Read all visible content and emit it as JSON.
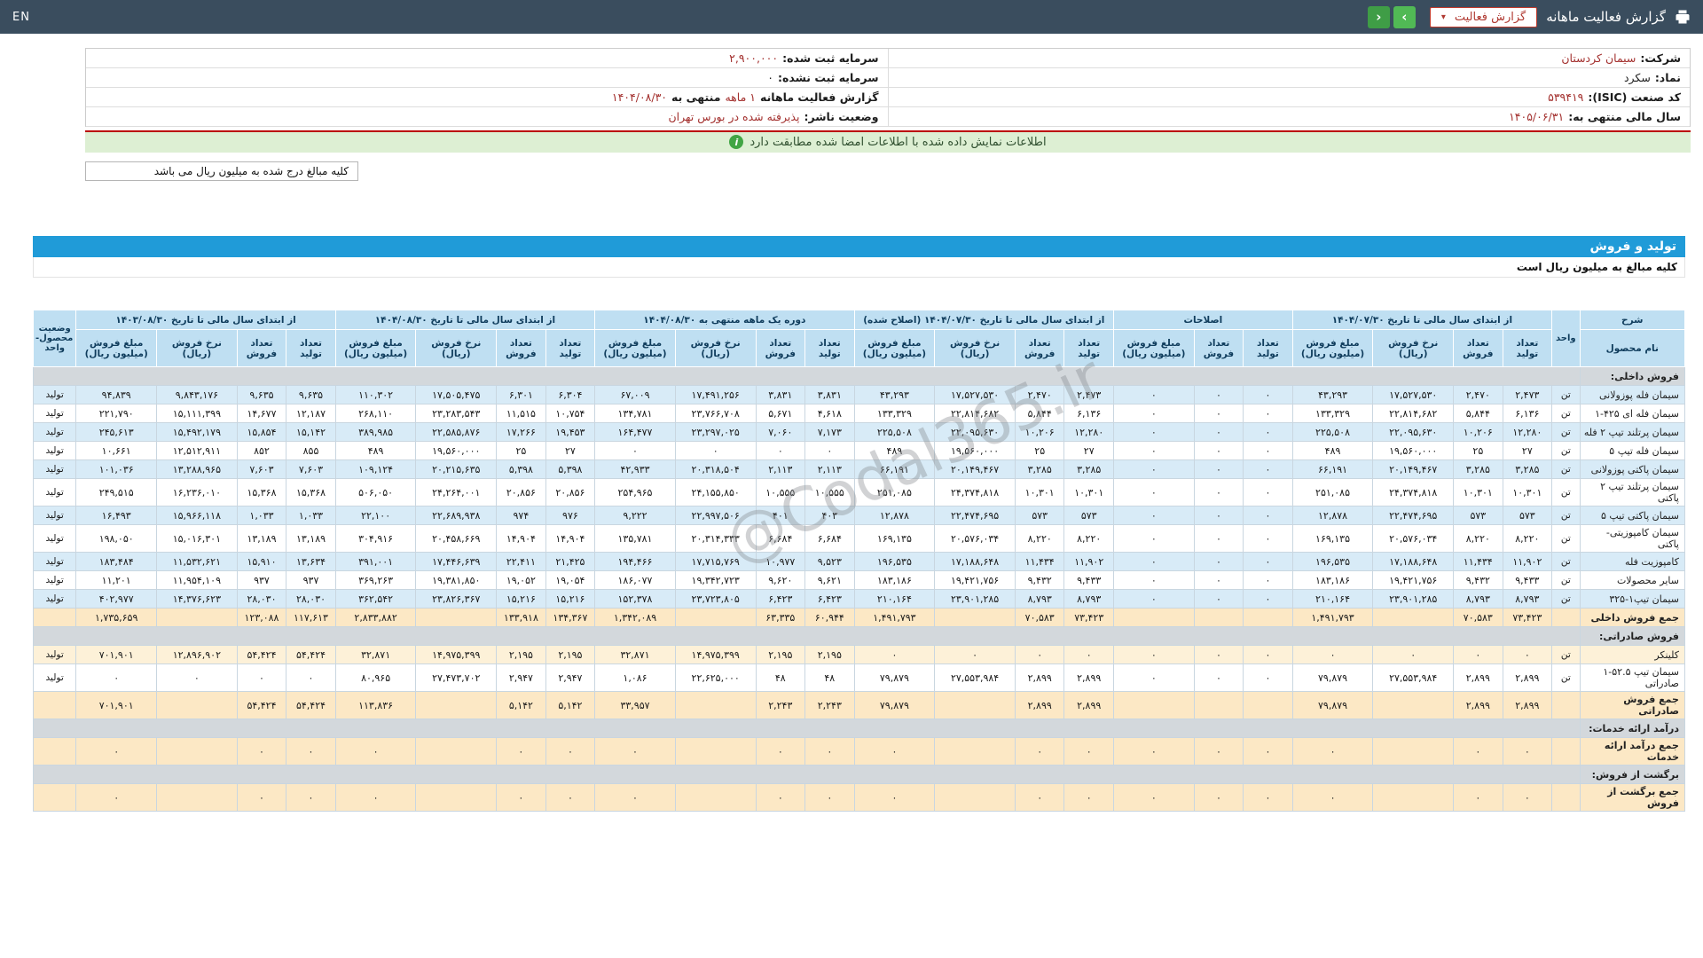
{
  "navbar": {
    "title": "گزارش فعالیت ماهانه",
    "report_select": "گزارش فعالیت",
    "prev": "‹",
    "next": "›",
    "lang": "EN"
  },
  "info": {
    "company_label": "شرکت:",
    "company": "سیمان کردستان",
    "symbol_label": "نماد:",
    "symbol": "سکرد",
    "isic_label": "کد صنعت (ISIC):",
    "isic": "۵۳۹۴۱۹",
    "fiscal_year_label": "سال مالی منتهی به:",
    "fiscal_year": "۱۴۰۵/۰۶/۳۱",
    "registered_capital_label": "سرمایه ثبت شده:",
    "registered_capital": "۲,۹۰۰,۰۰۰",
    "unregistered_capital_label": "سرمایه ثبت نشده:",
    "unregistered_capital": "۰",
    "report_period_label": "گزارش فعالیت ماهانه",
    "report_period": "۱ ماهه",
    "report_period_mid": "منتهی به",
    "report_period_date": "۱۴۰۴/۰۸/۳۰",
    "issuer_status_label": "وضعیت ناشر:",
    "issuer_status": "پذیرفته شده در بورس تهران"
  },
  "signature_notice": "اطلاعات نمایش داده شده با اطلاعات امضا شده مطابقت دارد",
  "info_icon": "i",
  "amounts_note": "کلیه مبالغ درج شده به میلیون ریال می باشد",
  "section_title": "تولید و فروش",
  "section_subtitle": "کلیه مبالغ به میلیون ریال است",
  "watermark": "@Codal365.ir",
  "table": {
    "desc_header": "شرح",
    "product_header": "نام محصول",
    "unit_header": "واحد",
    "status_header": "وضعیت محصول-واحد",
    "groups": [
      {
        "label": "از ابتدای سال مالی تا تاریخ ۱۴۰۴/۰۷/۳۰",
        "cols": [
          "تعداد تولید",
          "تعداد فروش",
          "نرخ فروش (ریال)",
          "مبلغ فروش (میلیون ریال)"
        ]
      },
      {
        "label": "اصلاحات",
        "cols": [
          "تعداد تولید",
          "تعداد فروش",
          "مبلغ فروش (میلیون ریال)"
        ]
      },
      {
        "label": "از ابتدای سال مالی تا تاریخ ۱۴۰۴/۰۷/۳۰ (اصلاح شده)",
        "cols": [
          "تعداد تولید",
          "تعداد فروش",
          "نرخ فروش (ریال)",
          "مبلغ فروش (میلیون ریال)"
        ]
      },
      {
        "label": "دوره یک ماهه منتهی به ۱۴۰۴/۰۸/۳۰",
        "cols": [
          "تعداد تولید",
          "تعداد فروش",
          "نرخ فروش (ریال)",
          "مبلغ فروش (میلیون ریال)"
        ]
      },
      {
        "label": "از ابتدای سال مالی تا تاریخ ۱۴۰۴/۰۸/۳۰",
        "cols": [
          "تعداد تولید",
          "تعداد فروش",
          "نرخ فروش (ریال)",
          "مبلغ فروش (میلیون ریال)"
        ]
      },
      {
        "label": "از ابتدای سال مالی تا تاریخ ۱۴۰۳/۰۸/۳۰",
        "cols": [
          "تعداد تولید",
          "تعداد فروش",
          "نرخ فروش (ریال)",
          "مبلغ فروش (میلیون ریال)"
        ]
      }
    ],
    "rows": [
      {
        "kind": "section",
        "name": "فروش داخلی:"
      },
      {
        "kind": "product",
        "shade": "blue",
        "name": "سیمان فله پوزولانی",
        "unit": "تن",
        "status": "تولید",
        "cells": [
          "۲,۴۷۳",
          "۲,۴۷۰",
          "۱۷,۵۲۷,۵۳۰",
          "۴۳,۲۹۳",
          "۰",
          "۰",
          "۰",
          "۲,۴۷۳",
          "۲,۴۷۰",
          "۱۷,۵۲۷,۵۳۰",
          "۴۳,۲۹۳",
          "۳,۸۳۱",
          "۳,۸۳۱",
          "۱۷,۴۹۱,۲۵۶",
          "۶۷,۰۰۹",
          "۶,۳۰۴",
          "۶,۳۰۱",
          "۱۷,۵۰۵,۴۷۵",
          "۱۱۰,۳۰۲",
          "۹,۶۳۵",
          "۹,۶۳۵",
          "۹,۸۴۳,۱۷۶",
          "۹۴,۸۳۹"
        ]
      },
      {
        "kind": "product",
        "shade": "white",
        "name": "سیمان فله ای ۴۲۵-۱",
        "unit": "تن",
        "status": "تولید",
        "cells": [
          "۶,۱۳۶",
          "۵,۸۴۴",
          "۲۲,۸۱۴,۶۸۲",
          "۱۳۳,۳۲۹",
          "۰",
          "۰",
          "۰",
          "۶,۱۳۶",
          "۵,۸۴۴",
          "۲۲,۸۱۴,۶۸۲",
          "۱۳۳,۳۲۹",
          "۴,۶۱۸",
          "۵,۶۷۱",
          "۲۳,۷۶۶,۷۰۸",
          "۱۳۴,۷۸۱",
          "۱۰,۷۵۴",
          "۱۱,۵۱۵",
          "۲۳,۲۸۳,۵۴۳",
          "۲۶۸,۱۱۰",
          "۱۲,۱۸۷",
          "۱۴,۶۷۷",
          "۱۵,۱۱۱,۳۹۹",
          "۲۲۱,۷۹۰"
        ]
      },
      {
        "kind": "product",
        "shade": "blue",
        "name": "سیمان پرتلند تیپ ۲ فله",
        "unit": "تن",
        "status": "تولید",
        "cells": [
          "۱۲,۲۸۰",
          "۱۰,۲۰۶",
          "۲۲,۰۹۵,۶۳۰",
          "۲۲۵,۵۰۸",
          "۰",
          "۰",
          "۰",
          "۱۲,۲۸۰",
          "۱۰,۲۰۶",
          "۲۲,۰۹۵,۶۳۰",
          "۲۲۵,۵۰۸",
          "۷,۱۷۳",
          "۷,۰۶۰",
          "۲۳,۲۹۷,۰۲۵",
          "۱۶۴,۴۷۷",
          "۱۹,۴۵۳",
          "۱۷,۲۶۶",
          "۲۲,۵۸۵,۸۷۶",
          "۳۸۹,۹۸۵",
          "۱۵,۱۴۲",
          "۱۵,۸۵۴",
          "۱۵,۴۹۲,۱۷۹",
          "۲۴۵,۶۱۳"
        ]
      },
      {
        "kind": "product",
        "shade": "white",
        "name": "سیمان فله تیپ ۵",
        "unit": "تن",
        "status": "تولید",
        "cells": [
          "۲۷",
          "۲۵",
          "۱۹,۵۶۰,۰۰۰",
          "۴۸۹",
          "۰",
          "۰",
          "۰",
          "۲۷",
          "۲۵",
          "۱۹,۵۶۰,۰۰۰",
          "۴۸۹",
          "۰",
          "۰",
          "۰",
          "۰",
          "۲۷",
          "۲۵",
          "۱۹,۵۶۰,۰۰۰",
          "۴۸۹",
          "۸۵۵",
          "۸۵۲",
          "۱۲,۵۱۲,۹۱۱",
          "۱۰,۶۶۱"
        ]
      },
      {
        "kind": "product",
        "shade": "blue",
        "name": "سیمان پاکتی پوزولانی",
        "unit": "تن",
        "status": "تولید",
        "cells": [
          "۳,۲۸۵",
          "۳,۲۸۵",
          "۲۰,۱۴۹,۴۶۷",
          "۶۶,۱۹۱",
          "۰",
          "۰",
          "۰",
          "۳,۲۸۵",
          "۳,۲۸۵",
          "۲۰,۱۴۹,۴۶۷",
          "۶۶,۱۹۱",
          "۲,۱۱۳",
          "۲,۱۱۳",
          "۲۰,۳۱۸,۵۰۴",
          "۴۲,۹۳۳",
          "۵,۳۹۸",
          "۵,۳۹۸",
          "۲۰,۲۱۵,۶۳۵",
          "۱۰۹,۱۲۴",
          "۷,۶۰۳",
          "۷,۶۰۳",
          "۱۳,۲۸۸,۹۶۵",
          "۱۰۱,۰۳۶"
        ]
      },
      {
        "kind": "product",
        "shade": "white",
        "name": "سیمان پرتلند تیپ ۲ پاکتی",
        "unit": "تن",
        "status": "تولید",
        "cells": [
          "۱۰,۳۰۱",
          "۱۰,۳۰۱",
          "۲۴,۳۷۴,۸۱۸",
          "۲۵۱,۰۸۵",
          "۰",
          "۰",
          "۰",
          "۱۰,۳۰۱",
          "۱۰,۳۰۱",
          "۲۴,۳۷۴,۸۱۸",
          "۲۵۱,۰۸۵",
          "۱۰,۵۵۵",
          "۱۰,۵۵۵",
          "۲۴,۱۵۵,۸۵۰",
          "۲۵۴,۹۶۵",
          "۲۰,۸۵۶",
          "۲۰,۸۵۶",
          "۲۴,۲۶۴,۰۰۱",
          "۵۰۶,۰۵۰",
          "۱۵,۳۶۸",
          "۱۵,۳۶۸",
          "۱۶,۲۳۶,۰۱۰",
          "۲۴۹,۵۱۵"
        ]
      },
      {
        "kind": "product",
        "shade": "blue",
        "name": "سیمان پاکتی تیپ ۵",
        "unit": "تن",
        "status": "تولید",
        "cells": [
          "۵۷۳",
          "۵۷۳",
          "۲۲,۴۷۴,۶۹۵",
          "۱۲,۸۷۸",
          "۰",
          "۰",
          "۰",
          "۵۷۳",
          "۵۷۳",
          "۲۲,۴۷۴,۶۹۵",
          "۱۲,۸۷۸",
          "۴۰۳",
          "۴۰۱",
          "۲۲,۹۹۷,۵۰۶",
          "۹,۲۲۲",
          "۹۷۶",
          "۹۷۴",
          "۲۲,۶۸۹,۹۳۸",
          "۲۲,۱۰۰",
          "۱,۰۳۳",
          "۱,۰۳۳",
          "۱۵,۹۶۶,۱۱۸",
          "۱۶,۴۹۳"
        ]
      },
      {
        "kind": "product",
        "shade": "white",
        "name": "سیمان کامپوزیتی- پاکتی",
        "unit": "تن",
        "status": "تولید",
        "cells": [
          "۸,۲۲۰",
          "۸,۲۲۰",
          "۲۰,۵۷۶,۰۳۴",
          "۱۶۹,۱۳۵",
          "۰",
          "۰",
          "۰",
          "۸,۲۲۰",
          "۸,۲۲۰",
          "۲۰,۵۷۶,۰۳۴",
          "۱۶۹,۱۳۵",
          "۶,۶۸۴",
          "۶,۶۸۴",
          "۲۰,۳۱۴,۳۳۳",
          "۱۳۵,۷۸۱",
          "۱۴,۹۰۴",
          "۱۴,۹۰۴",
          "۲۰,۴۵۸,۶۶۹",
          "۳۰۴,۹۱۶",
          "۱۳,۱۸۹",
          "۱۳,۱۸۹",
          "۱۵,۰۱۶,۳۰۱",
          "۱۹۸,۰۵۰"
        ]
      },
      {
        "kind": "product",
        "shade": "blue",
        "name": "کامپوزیت فله",
        "unit": "تن",
        "status": "تولید",
        "cells": [
          "۱۱,۹۰۲",
          "۱۱,۴۳۴",
          "۱۷,۱۸۸,۶۴۸",
          "۱۹۶,۵۳۵",
          "۰",
          "۰",
          "۰",
          "۱۱,۹۰۲",
          "۱۱,۴۳۴",
          "۱۷,۱۸۸,۶۴۸",
          "۱۹۶,۵۳۵",
          "۹,۵۲۳",
          "۱۰,۹۷۷",
          "۱۷,۷۱۵,۷۶۹",
          "۱۹۴,۴۶۶",
          "۲۱,۴۲۵",
          "۲۲,۴۱۱",
          "۱۷,۴۴۶,۶۳۹",
          "۳۹۱,۰۰۱",
          "۱۳,۶۳۴",
          "۱۵,۹۱۰",
          "۱۱,۵۳۲,۶۲۱",
          "۱۸۳,۴۸۴"
        ]
      },
      {
        "kind": "product",
        "shade": "white",
        "name": "سایر محصولات",
        "unit": "تن",
        "status": "تولید",
        "cells": [
          "۹,۴۳۳",
          "۹,۴۳۲",
          "۱۹,۴۲۱,۷۵۶",
          "۱۸۳,۱۸۶",
          "۰",
          "۰",
          "۰",
          "۹,۴۳۳",
          "۹,۴۳۲",
          "۱۹,۴۲۱,۷۵۶",
          "۱۸۳,۱۸۶",
          "۹,۶۲۱",
          "۹,۶۲۰",
          "۱۹,۳۴۲,۷۲۳",
          "۱۸۶,۰۷۷",
          "۱۹,۰۵۴",
          "۱۹,۰۵۲",
          "۱۹,۳۸۱,۸۵۰",
          "۳۶۹,۲۶۳",
          "۹۳۷",
          "۹۳۷",
          "۱۱,۹۵۴,۱۰۹",
          "۱۱,۲۰۱"
        ]
      },
      {
        "kind": "product",
        "shade": "blue",
        "name": "سیمان تیپ۱-۳۲۵",
        "unit": "تن",
        "status": "تولید",
        "cells": [
          "۸,۷۹۳",
          "۸,۷۹۳",
          "۲۳,۹۰۱,۲۸۵",
          "۲۱۰,۱۶۴",
          "۰",
          "۰",
          "۰",
          "۸,۷۹۳",
          "۸,۷۹۳",
          "۲۳,۹۰۱,۲۸۵",
          "۲۱۰,۱۶۴",
          "۶,۴۲۳",
          "۶,۴۲۳",
          "۲۳,۷۲۳,۸۰۵",
          "۱۵۲,۳۷۸",
          "۱۵,۲۱۶",
          "۱۵,۲۱۶",
          "۲۳,۸۲۶,۳۶۷",
          "۳۶۲,۵۴۲",
          "۲۸,۰۳۰",
          "۲۸,۰۳۰",
          "۱۴,۳۷۶,۶۲۳",
          "۴۰۲,۹۷۷"
        ]
      },
      {
        "kind": "total",
        "name": "جمع فروش داخلی",
        "unit": "",
        "status": "",
        "cells": [
          "۷۳,۴۲۳",
          "۷۰,۵۸۳",
          "",
          "۱,۴۹۱,۷۹۳",
          "",
          "",
          "",
          "۷۳,۴۲۳",
          "۷۰,۵۸۳",
          "",
          "۱,۴۹۱,۷۹۳",
          "۶۰,۹۴۴",
          "۶۳,۳۳۵",
          "",
          "۱,۳۴۲,۰۸۹",
          "۱۳۴,۳۶۷",
          "۱۳۳,۹۱۸",
          "",
          "۲,۸۳۳,۸۸۲",
          "۱۱۷,۶۱۳",
          "۱۲۳,۰۸۸",
          "",
          "۱,۷۳۵,۶۵۹"
        ]
      },
      {
        "kind": "section",
        "name": "فروش صادراتی:"
      },
      {
        "kind": "product",
        "shade": "cream",
        "name": "کلینکر",
        "unit": "تن",
        "status": "تولید",
        "cells": [
          "۰",
          "۰",
          "۰",
          "۰",
          "۰",
          "۰",
          "۰",
          "۰",
          "۰",
          "۰",
          "۰",
          "۲,۱۹۵",
          "۲,۱۹۵",
          "۱۴,۹۷۵,۳۹۹",
          "۳۲,۸۷۱",
          "۲,۱۹۵",
          "۲,۱۹۵",
          "۱۴,۹۷۵,۳۹۹",
          "۳۲,۸۷۱",
          "۵۴,۴۲۴",
          "۵۴,۴۲۴",
          "۱۲,۸۹۶,۹۰۲",
          "۷۰۱,۹۰۱"
        ]
      },
      {
        "kind": "product",
        "shade": "white",
        "name": "سیمان تیپ ۵۲.۵-۱ صادراتی",
        "unit": "تن",
        "status": "تولید",
        "cells": [
          "۲,۸۹۹",
          "۲,۸۹۹",
          "۲۷,۵۵۳,۹۸۴",
          "۷۹,۸۷۹",
          "۰",
          "۰",
          "۰",
          "۲,۸۹۹",
          "۲,۸۹۹",
          "۲۷,۵۵۳,۹۸۴",
          "۷۹,۸۷۹",
          "۴۸",
          "۴۸",
          "۲۲,۶۲۵,۰۰۰",
          "۱,۰۸۶",
          "۲,۹۴۷",
          "۲,۹۴۷",
          "۲۷,۴۷۳,۷۰۲",
          "۸۰,۹۶۵",
          "۰",
          "۰",
          "۰",
          "۰"
        ]
      },
      {
        "kind": "total",
        "name": "جمع فروش صادراتی",
        "unit": "",
        "status": "",
        "cells": [
          "۲,۸۹۹",
          "۲,۸۹۹",
          "",
          "۷۹,۸۷۹",
          "",
          "",
          "",
          "۲,۸۹۹",
          "۲,۸۹۹",
          "",
          "۷۹,۸۷۹",
          "۲,۲۴۳",
          "۲,۲۴۳",
          "",
          "۳۳,۹۵۷",
          "۵,۱۴۲",
          "۵,۱۴۲",
          "",
          "۱۱۳,۸۳۶",
          "۵۴,۴۲۴",
          "۵۴,۴۲۴",
          "",
          "۷۰۱,۹۰۱"
        ]
      },
      {
        "kind": "section",
        "name": "درآمد ارائه خدمات:"
      },
      {
        "kind": "total",
        "name": "جمع درآمد ارائه خدمات",
        "unit": "",
        "status": "",
        "cells": [
          "۰",
          "۰",
          "",
          "۰",
          "۰",
          "۰",
          "۰",
          "۰",
          "۰",
          "",
          "۰",
          "۰",
          "۰",
          "",
          "۰",
          "۰",
          "۰",
          "",
          "۰",
          "۰",
          "۰",
          "",
          "۰"
        ]
      },
      {
        "kind": "section",
        "name": "برگشت از فروش:"
      },
      {
        "kind": "total",
        "name": "جمع برگشت از فروش",
        "unit": "",
        "status": "",
        "cells": [
          "۰",
          "۰",
          "",
          "۰",
          "۰",
          "۰",
          "۰",
          "۰",
          "۰",
          "",
          "۰",
          "۰",
          "۰",
          "",
          "۰",
          "۰",
          "۰",
          "",
          "۰",
          "۰",
          "۰",
          "",
          "۰"
        ]
      }
    ]
  }
}
